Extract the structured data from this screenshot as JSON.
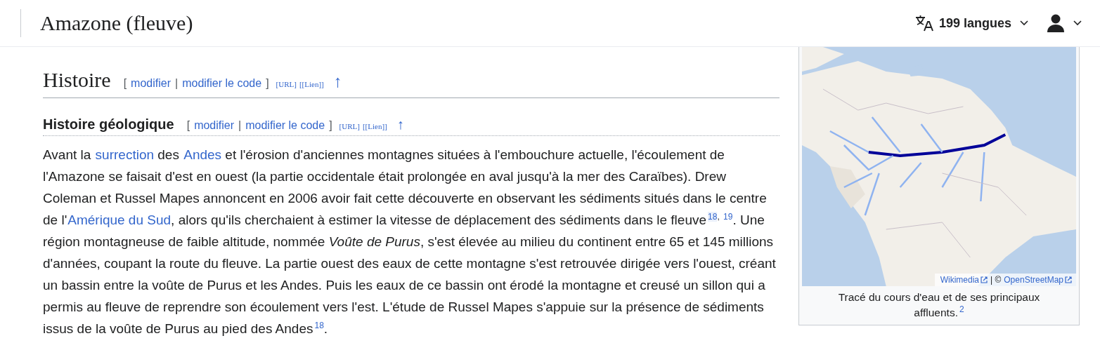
{
  "header": {
    "title": "Amazone (fleuve)",
    "languages": "199 langues"
  },
  "section": {
    "title": "Histoire",
    "open_bracket": "[",
    "separator": "|",
    "close_bracket": "]",
    "edit_links": [
      "modifier",
      "modifier le code"
    ],
    "extra_links": [
      "[URL]",
      "[[Lien]]"
    ],
    "arrow": "↑"
  },
  "subsection": {
    "title": "Histoire géologique",
    "open_bracket": "[",
    "separator": "|",
    "close_bracket": "]",
    "edit_links": [
      "modifier",
      "modifier le code"
    ],
    "extra_links": [
      "[URL]",
      "[[Lien]]"
    ],
    "arrow": "↑"
  },
  "paragraph": [
    {
      "kind": "text",
      "text": "Avant la "
    },
    {
      "kind": "link",
      "text": "surrection"
    },
    {
      "kind": "text",
      "text": " des "
    },
    {
      "kind": "link",
      "text": "Andes"
    },
    {
      "kind": "text",
      "text": " et l'érosion d'anciennes montagnes situées à l'embouchure actuelle, l'écoulement de l'Amazone se faisait d'est en ouest (la partie occidentale était prolongée en aval jusqu'à la mer des Caraïbes). Drew Coleman et Russel Mapes annoncent en 2006 avoir fait cette découverte en observant les sédiments situés dans le centre de l'"
    },
    {
      "kind": "link",
      "text": "Amérique du Sud"
    },
    {
      "kind": "text",
      "text": ", alors qu'ils cherchaient à estimer la vitesse de déplacement des sédiments dans le fleuve"
    },
    {
      "kind": "ref",
      "text": "18",
      "selected": true
    },
    {
      "kind": "sep",
      "text": ", "
    },
    {
      "kind": "ref",
      "text": "19",
      "selected": false
    },
    {
      "kind": "text",
      "text": ". Une région montagneuse de faible altitude, nommée *Voûte de Purus*, s'est élevée au milieu du continent entre 65 et 145 millions d'années, coupant la route du fleuve. La partie ouest des eaux de cette montagne s'est retrouvée dirigée vers l'ouest, créant un bassin entre la voûte de Purus et les Andes. Puis les eaux de ce bassin ont érodé la montagne et creusé un sillon qui a permis au fleuve de reprendre son écoulement vers l'est. L'étude de Russel Mapes s'appuie sur la présence de sédiments issus de la voûte de Purus au pied des Andes"
    },
    {
      "kind": "ref",
      "text": "18",
      "selected": false
    },
    {
      "kind": "text",
      "text": "."
    }
  ],
  "figure": {
    "kind": "picture",
    "attribution": [
      {
        "kind": "link",
        "text": "Wikimedia"
      },
      {
        "kind": "text",
        "text": "| ©"
      },
      {
        "kind": "link",
        "text": "OpenStreetMap"
      }
    ],
    "caption": "Tracé du cours d'eau et de ses principaux affluents.",
    "caption_ref": "2"
  }
}
